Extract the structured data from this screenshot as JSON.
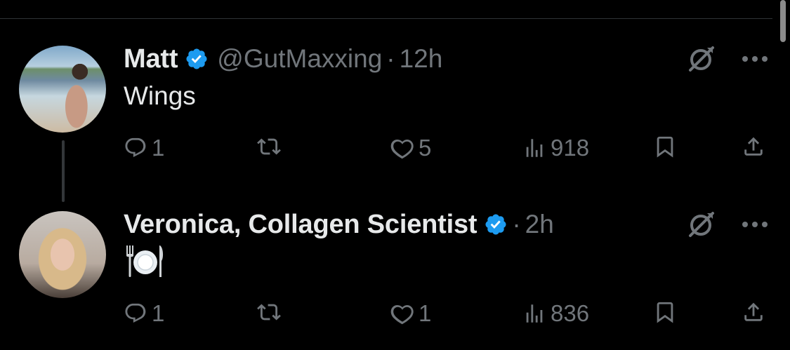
{
  "colors": {
    "background": "#000000",
    "text": "#e7e9ea",
    "muted": "#71767b",
    "verified": "#1d9bf0",
    "divider": "#2f3336"
  },
  "tweets": [
    {
      "name": "Matt",
      "handle": "@GutMaxxing",
      "separator": "·",
      "time": "12h",
      "text": "Wings",
      "reply_count": "1",
      "retweet_count": "",
      "like_count": "5",
      "view_count": "918"
    },
    {
      "name": "Veronica, Collagen Scientist",
      "handle": "",
      "separator": "·",
      "time": "2h",
      "text": "🍽️",
      "reply_count": "1",
      "retweet_count": "",
      "like_count": "1",
      "view_count": "836"
    }
  ],
  "icons": [
    "verified-badge-icon",
    "grok-icon",
    "more-icon",
    "reply-icon",
    "retweet-icon",
    "like-icon",
    "views-icon",
    "bookmark-icon",
    "share-icon",
    "plate-emoji"
  ]
}
